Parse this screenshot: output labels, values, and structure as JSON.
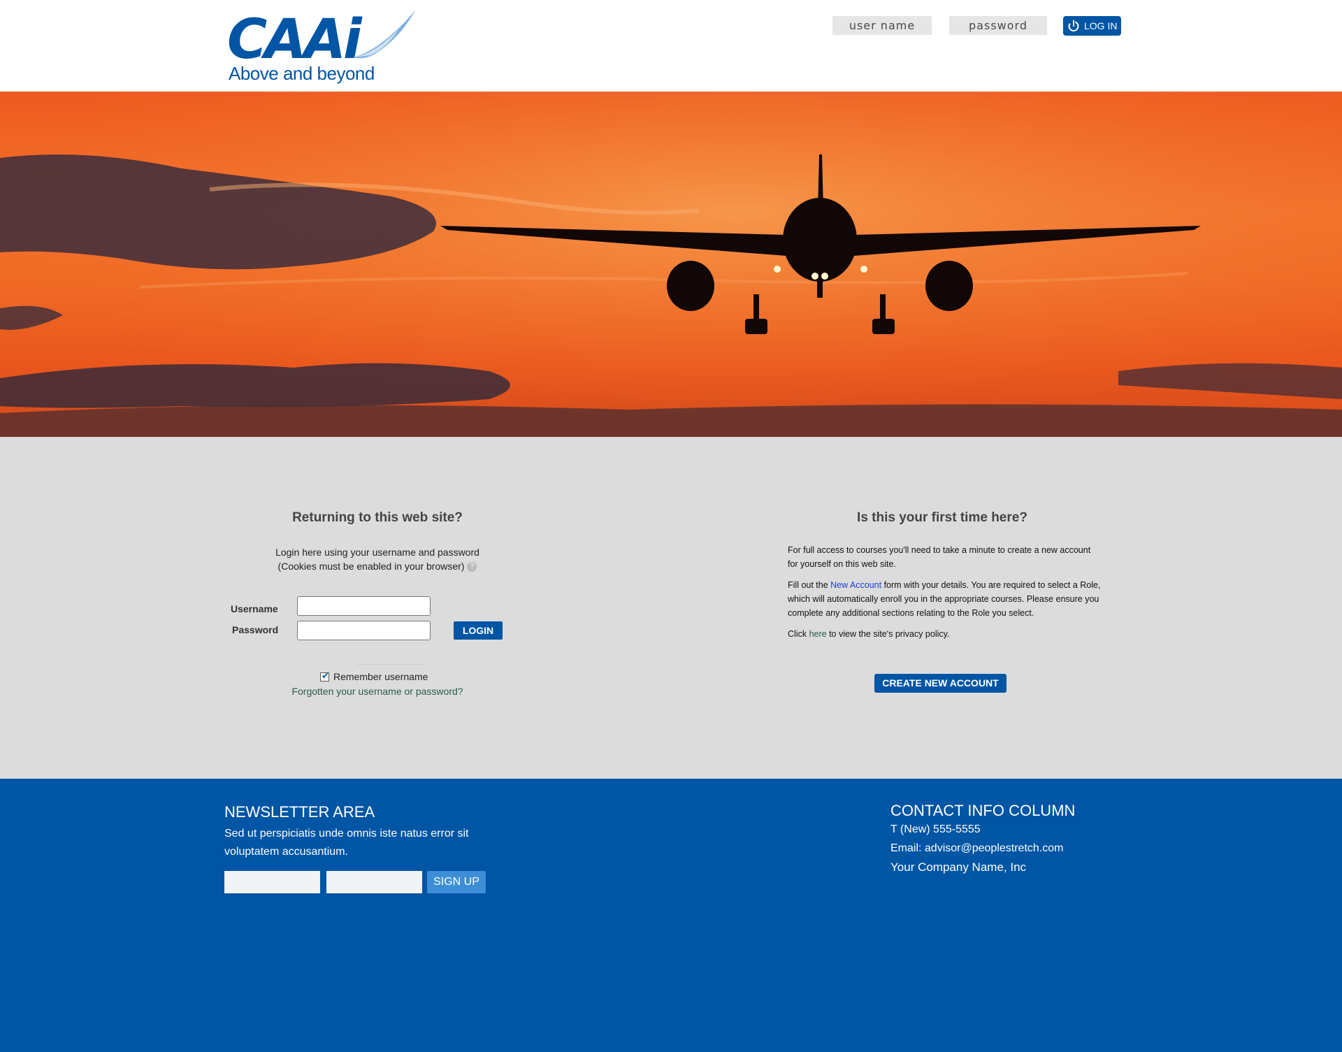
{
  "header": {
    "logo_text": "CAAi",
    "logo_tagline": "Above and beyond",
    "username_placeholder": "user name",
    "password_placeholder": "password",
    "login_label": "LOG IN"
  },
  "login_panel": {
    "title": "Returning to this web site?",
    "intro_line1": "Login here using your username and password",
    "intro_line2": "(Cookies must be enabled in your browser)",
    "help_glyph": "?",
    "username_label": "Username",
    "password_label": "Password",
    "login_button": "LOGIN",
    "remember_label": "Remember username",
    "remember_checked": true,
    "forgot_link": "Forgotten your username or password?"
  },
  "signup_panel": {
    "title": "Is this your first time here?",
    "para1": "For full access to courses you'll need to take a minute to create a new account for yourself on this web site.",
    "para2_before": "Fill out the ",
    "para2_link": "New Account",
    "para2_after": " form with your details. You are required to select a Role, which will automatically enroll you in the appropriate courses. Please ensure you complete any additional sections relating to the Role you select.",
    "para3_before": "Click ",
    "para3_link": "here",
    "para3_after": " to view the site's privacy policy.",
    "create_button": "CREATE NEW ACCOUNT"
  },
  "footer": {
    "newsletter_title": "NEWSLETTER AREA",
    "newsletter_text": "Sed ut perspiciatis unde omnis iste natus error sit voluptatem accusantium.",
    "signup_button": "SIGN UP",
    "contact_title": "CONTACT INFO COLUMN",
    "phone": "T (New) 555-5555",
    "email": "Email: advisor@peoplestretch.com",
    "company": "Your Company Name, Inc"
  },
  "colors": {
    "brand_blue": "#0055a4",
    "sky_orange": "#f06a25",
    "panel_gray": "#dcdcdc",
    "signup_button": "#3d8ed6"
  },
  "icons": [
    "power-icon",
    "help-icon",
    "checkbox-checked-icon",
    "airplane-silhouette"
  ]
}
